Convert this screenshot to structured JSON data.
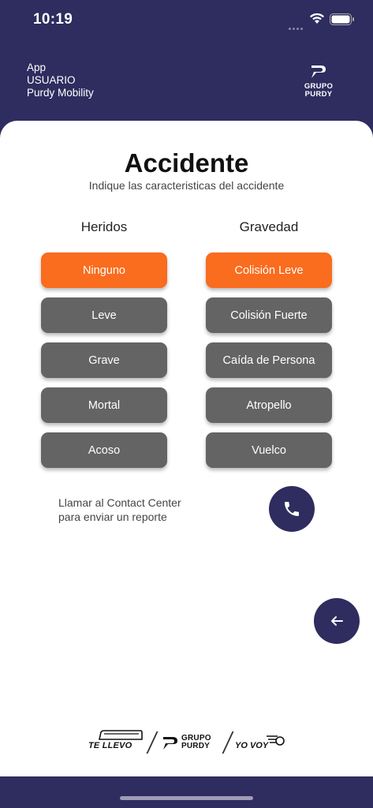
{
  "status_bar": {
    "time": "10:19"
  },
  "header": {
    "lines": [
      "App",
      "USUARIO",
      "Purdy Mobility"
    ],
    "logo_text": [
      "GRUPO",
      "PURDY"
    ]
  },
  "main": {
    "title": "Accidente",
    "subtitle": "Indique las caracteristicas del accidente",
    "heridos": {
      "label": "Heridos",
      "options": [
        "Ninguno",
        "Leve",
        "Grave",
        "Mortal",
        "Acoso"
      ],
      "selected": "Ninguno"
    },
    "gravedad": {
      "label": "Gravedad",
      "options": [
        "Colisión Leve",
        "Colisión Fuerte",
        "Caída de Persona",
        "Atropello",
        "Vuelco"
      ],
      "selected": "Colisión Leve"
    },
    "contact_text": [
      "Llamar al Contact Center",
      "para enviar un reporte"
    ]
  },
  "footer": {
    "logos": [
      "TE LLEVO",
      "GRUPO",
      "PURDY",
      "YO VOY"
    ]
  },
  "icons": {
    "phone": "phone-icon",
    "back": "arrow-left-icon",
    "wifi": "wifi-icon",
    "battery": "battery-icon"
  },
  "colors": {
    "primary": "#2f2c5f",
    "selected": "#fa6c1e",
    "option": "#646464"
  }
}
